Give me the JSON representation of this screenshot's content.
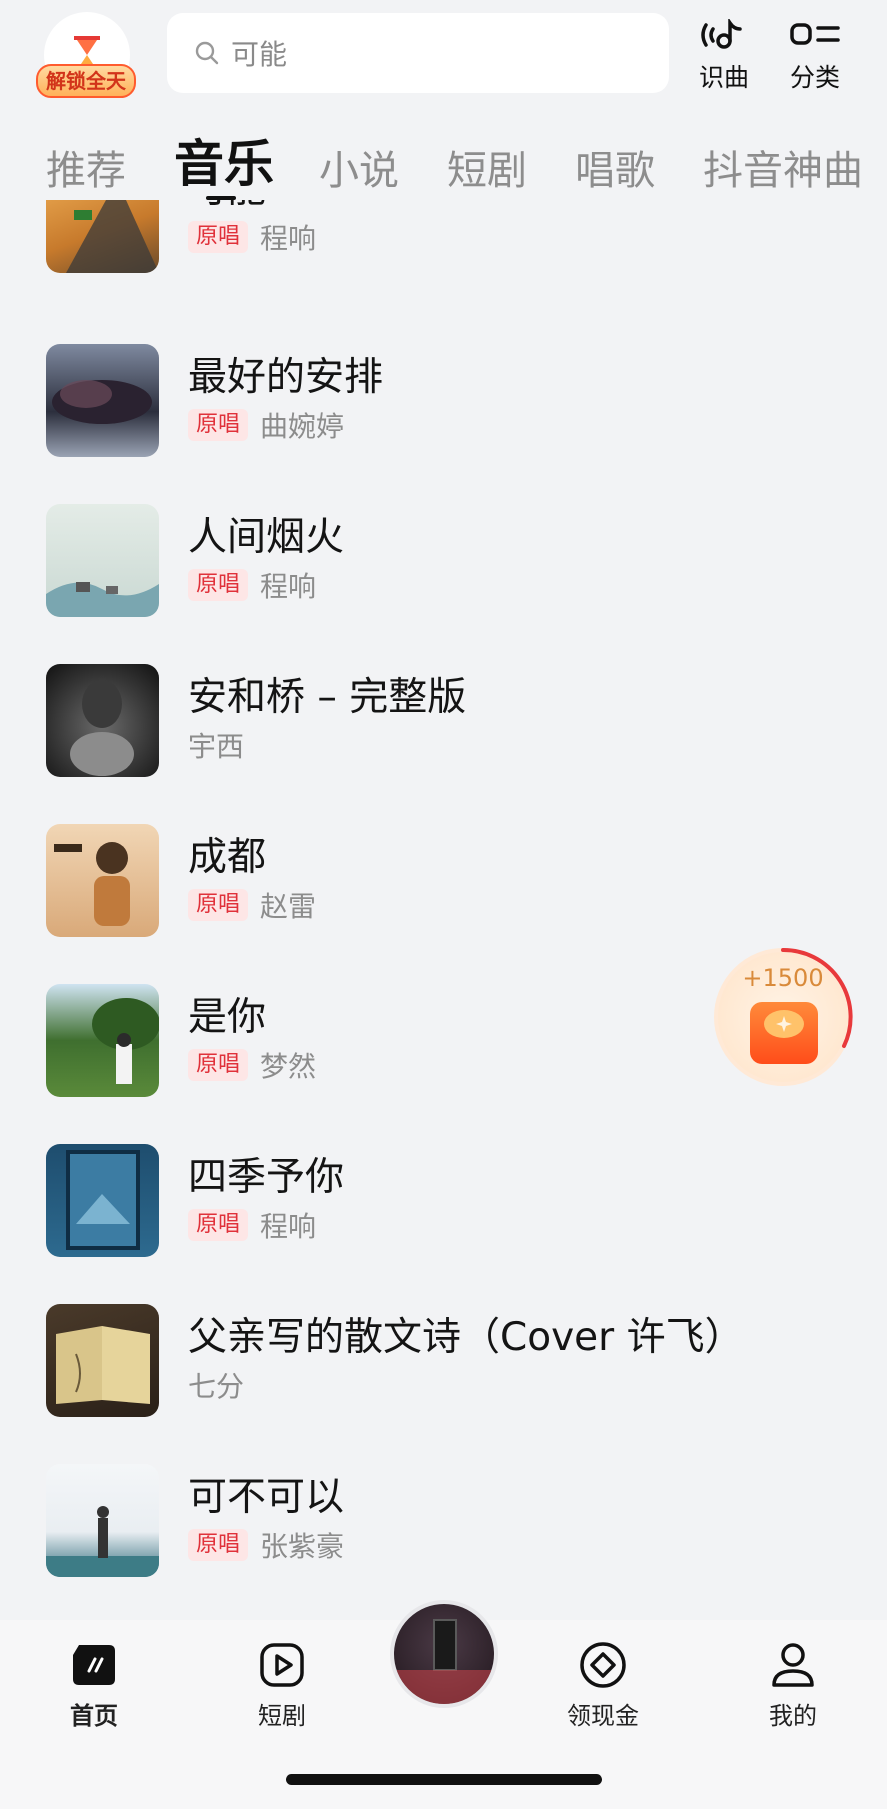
{
  "header": {
    "unlock_badge": "解锁全天",
    "search_placeholder": "可能",
    "recognize_label": "识曲",
    "category_label": "分类"
  },
  "tabs": [
    {
      "label": "推荐",
      "active": false
    },
    {
      "label": "音乐",
      "active": true
    },
    {
      "label": "小说",
      "active": false
    },
    {
      "label": "短剧",
      "active": false
    },
    {
      "label": "唱歌",
      "active": false
    },
    {
      "label": "抖音神曲",
      "active": false
    }
  ],
  "songs": [
    {
      "title": "可能",
      "tag": "原唱",
      "artist": "程响"
    },
    {
      "title": "最好的安排",
      "tag": "原唱",
      "artist": "曲婉婷"
    },
    {
      "title": "人间烟火",
      "tag": "原唱",
      "artist": "程响"
    },
    {
      "title": "安和桥 – 完整版",
      "tag": "",
      "artist": "宇西"
    },
    {
      "title": "成都",
      "tag": "原唱",
      "artist": "赵雷"
    },
    {
      "title": "是你",
      "tag": "原唱",
      "artist": "梦然"
    },
    {
      "title": "四季予你",
      "tag": "原唱",
      "artist": "程响"
    },
    {
      "title": "父亲写的散文诗（Cover 许飞）",
      "tag": "",
      "artist": "七分"
    },
    {
      "title": "可不可以",
      "tag": "原唱",
      "artist": "张紫豪"
    }
  ],
  "reward": {
    "text": "+1500",
    "progress": 0.4
  },
  "bottom_nav": {
    "home": "首页",
    "drama": "短剧",
    "cash": "领现金",
    "mine": "我的"
  },
  "colors": {
    "accent_red": "#e0313a",
    "background": "#f2f3f5"
  }
}
